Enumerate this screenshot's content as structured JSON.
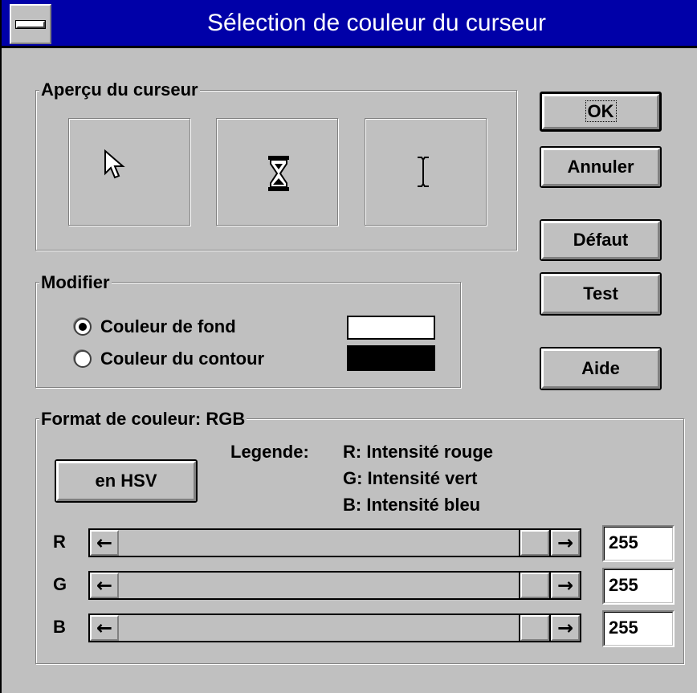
{
  "window": {
    "title": "Sélection de couleur du curseur"
  },
  "preview": {
    "label": "Aperçu du curseur",
    "cursors": [
      "arrow-cursor-icon",
      "hourglass-cursor-icon",
      "ibeam-cursor-icon"
    ]
  },
  "buttons": {
    "ok": "OK",
    "cancel": "Annuler",
    "default": "Défaut",
    "test": "Test",
    "help": "Aide",
    "to_hsv": "en HSV"
  },
  "modify": {
    "label": "Modifier",
    "options": [
      {
        "label": "Couleur de fond",
        "selected": true,
        "swatch": "#ffffff"
      },
      {
        "label": "Couleur du contour",
        "selected": false,
        "swatch": "#000000"
      }
    ]
  },
  "format": {
    "label": "Format de couleur: RGB",
    "legend_title": "Legende:",
    "legend": [
      "R: Intensité rouge",
      "G: Intensité vert",
      "B: Intensité bleu"
    ],
    "channels": [
      {
        "name": "R",
        "value": "255",
        "level": 1.0
      },
      {
        "name": "G",
        "value": "255",
        "level": 1.0
      },
      {
        "name": "B",
        "value": "255",
        "level": 1.0
      }
    ]
  },
  "colors": {
    "title_bar": "#0000a8",
    "face": "#c0c0c0"
  }
}
